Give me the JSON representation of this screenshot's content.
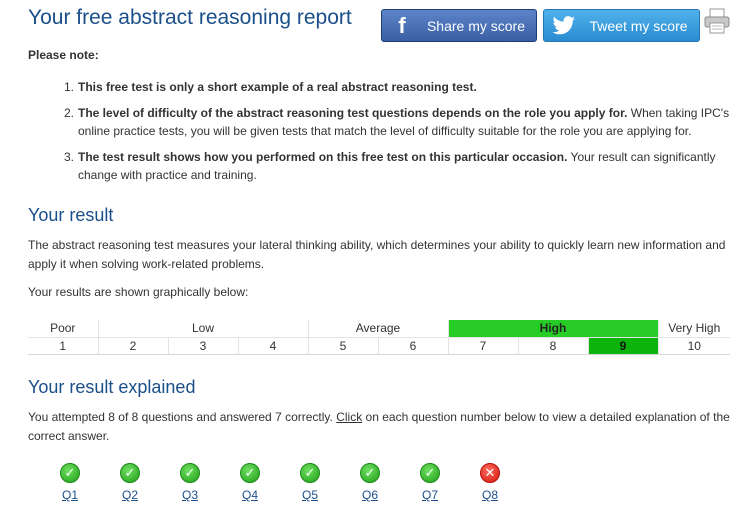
{
  "title": "Your free abstract reasoning report",
  "share": {
    "facebook_label": "Share my score",
    "twitter_label": "Tweet my score"
  },
  "note": {
    "heading": "Please note:",
    "items": [
      {
        "num": "1.",
        "bold": "This free test is only a short example of a real abstract reasoning test.",
        "rest": ""
      },
      {
        "num": "2.",
        "bold": "The level of difficulty of the abstract reasoning test questions depends on the role you apply for.",
        "rest": " When taking IPC's online practice tests, you will be given tests that match the level of difficulty suitable for the role you are applying for."
      },
      {
        "num": "3.",
        "bold": "The test result shows how you performed on this free test on this particular occasion.",
        "rest": " Your result can significantly change with practice and training."
      }
    ]
  },
  "result": {
    "heading": "Your result",
    "description": "The abstract reasoning test measures your lateral thinking ability, which determines your ability to quickly learn new information and apply it when solving work-related problems.",
    "graph_intro": "Your results are shown graphically below:",
    "scale": {
      "categories": [
        "Poor",
        "Low",
        "Average",
        "High",
        "Very High"
      ],
      "highlighted_category": "High",
      "numbers": [
        "1",
        "2",
        "3",
        "4",
        "5",
        "6",
        "7",
        "8",
        "9",
        "10"
      ],
      "selected": "9",
      "highlight_color": "#27cc27",
      "selected_color": "#0bb30b"
    }
  },
  "explained": {
    "heading": "Your result explained",
    "text_before": "You attempted 8 of 8 questions and answered 7 correctly. ",
    "link": "Click",
    "text_after": " on each question number below to view a detailed explanation of the correct answer.",
    "questions": [
      {
        "label": "Q1",
        "correct": true
      },
      {
        "label": "Q2",
        "correct": true
      },
      {
        "label": "Q3",
        "correct": true
      },
      {
        "label": "Q4",
        "correct": true
      },
      {
        "label": "Q5",
        "correct": true
      },
      {
        "label": "Q6",
        "correct": true
      },
      {
        "label": "Q7",
        "correct": true
      },
      {
        "label": "Q8",
        "correct": false
      }
    ]
  }
}
